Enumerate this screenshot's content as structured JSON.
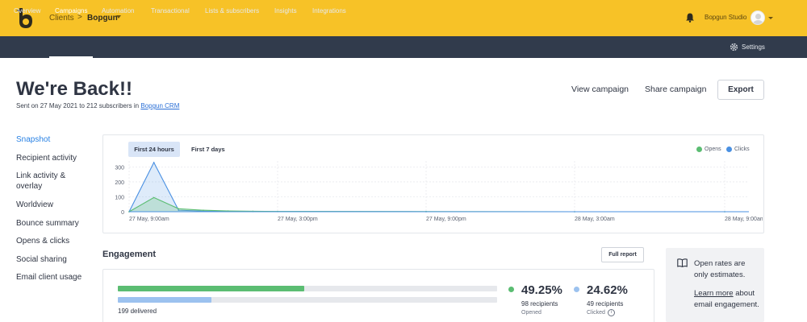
{
  "topbar": {
    "breadcrumb": [
      "Clients",
      "Bopgun"
    ],
    "breadcrumb_separator": ">",
    "account_name": "Bopgun Studio",
    "brand_color": "#f7c227"
  },
  "nav": {
    "items": [
      "Overview",
      "Campaigns",
      "Automation",
      "Transactional",
      "Lists & subscribers",
      "Insights",
      "Integrations"
    ],
    "active": "Campaigns",
    "settings_label": "Settings",
    "bg_color": "#313b4c"
  },
  "header": {
    "title": "We're Back!!",
    "subtitle_prefix": "Sent on 27 May 2021 to 212 subscribers in ",
    "subtitle_link": "Bopgun CRM",
    "view_campaign": "View campaign",
    "share_campaign": "Share campaign",
    "export": "Export"
  },
  "side_menu": {
    "items": [
      "Snapshot",
      "Recipient activity",
      "Link activity & overlay",
      "Worldview",
      "Bounce summary",
      "Opens & clicks",
      "Social sharing",
      "Email client usage"
    ],
    "active": "Snapshot"
  },
  "chart_tabs": {
    "items": [
      "First 24 hours",
      "First 7 days"
    ],
    "active": "First 24 hours"
  },
  "chart_data": {
    "type": "area",
    "x": [
      "27 May, 9:00am",
      "27 May, 10:00am",
      "27 May, 11:00am",
      "27 May, 12:00pm",
      "27 May, 1:00pm",
      "27 May, 2:00pm",
      "27 May, 3:00pm",
      "27 May, 9:00pm",
      "28 May, 3:00am",
      "28 May, 9:00am"
    ],
    "x_tick_labels": [
      "27 May, 9:00am",
      "27 May, 3:00pm",
      "27 May, 9:00pm",
      "28 May, 3:00am",
      "28 May, 9:00am"
    ],
    "series": [
      {
        "name": "Opens",
        "color": "#5bbd72",
        "values": [
          0,
          95,
          20,
          10,
          5,
          3,
          2,
          1,
          0,
          0
        ]
      },
      {
        "name": "Clicks",
        "color": "#4a90e2",
        "values": [
          0,
          330,
          10,
          4,
          2,
          1,
          1,
          0,
          0,
          0
        ]
      }
    ],
    "y_ticks": [
      0,
      100,
      200,
      300
    ],
    "ylim": [
      0,
      340
    ],
    "grid": true,
    "legend": "top-right"
  },
  "engagement": {
    "title": "Engagement",
    "full_report": "Full report",
    "delivered_label": "199 delivered",
    "opened_fraction": 0.4925,
    "clicked_fraction": 0.2462,
    "opened": {
      "pct": "49.25%",
      "recipients": "98 recipients",
      "label": "Opened",
      "color": "#5bbd72"
    },
    "clicked": {
      "pct": "24.62%",
      "recipients": "49 recipients",
      "label": "Clicked",
      "color": "#9cc2ef"
    },
    "info_glyph": "i"
  },
  "info_box": {
    "text": "Open rates are only estimates.",
    "link_text": "Learn more",
    "link_suffix": "about email engagement."
  }
}
